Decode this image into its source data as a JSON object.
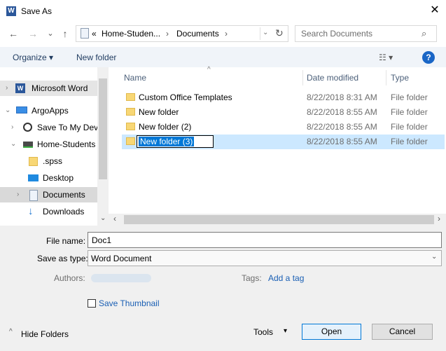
{
  "window": {
    "title": "Save As",
    "close_symbol": "✕"
  },
  "nav": {
    "back": "←",
    "forward": "→",
    "recent": "⌄",
    "up": "↑",
    "breadcrumb": [
      "«",
      "Home-Studen...",
      "›",
      "Documents",
      "›"
    ],
    "refresh": "↻",
    "search_placeholder": "Search Documents"
  },
  "toolbar": {
    "organize": "Organize ▾",
    "new_folder": "New folder",
    "view_glyph": "☷ ▾",
    "help": "?"
  },
  "sidebar": {
    "items": [
      {
        "label": "Microsoft Word",
        "chevron": "›",
        "icon": "word-icon"
      },
      {
        "label": "ArgoApps",
        "chevron": "⌄",
        "icon": "pc-icon"
      },
      {
        "label": "Save To My Devi",
        "chevron": "›",
        "icon": "disc-icon"
      },
      {
        "label": "Home-Students",
        "chevron": "⌄",
        "icon": "drive-icon"
      },
      {
        "label": ".spss",
        "chevron": "",
        "icon": "folder-icon"
      },
      {
        "label": "Desktop",
        "chevron": "",
        "icon": "desktop-icon"
      },
      {
        "label": "Documents",
        "chevron": "›",
        "icon": "documents-icon"
      },
      {
        "label": "Downloads",
        "chevron": "",
        "icon": "download-icon"
      }
    ],
    "scroll_down": "⌄"
  },
  "columns": {
    "name": "Name",
    "date": "Date modified",
    "type": "Type",
    "sort_arrow": "^"
  },
  "files": [
    {
      "name": "Custom Office Templates",
      "date": "8/22/2018 8:31 AM",
      "type": "File folder"
    },
    {
      "name": "New folder",
      "date": "8/22/2018 8:55 AM",
      "type": "File folder"
    },
    {
      "name": "New folder (2)",
      "date": "8/22/2018 8:55 AM",
      "type": "File folder"
    },
    {
      "name": "New folder (3)",
      "date": "8/22/2018 8:55 AM",
      "type": "File folder"
    }
  ],
  "scrollbar": {
    "left": "‹",
    "right": "›"
  },
  "form": {
    "file_name_label": "File name:",
    "file_name_value": "Doc1",
    "save_type_label": "Save as type:",
    "save_type_value": "Word Document",
    "dropdown_chevron": "⌄",
    "authors_label": "Authors:",
    "tags_label": "Tags:",
    "tags_link": "Add a tag",
    "thumbnail_label": "Save Thumbnail"
  },
  "footer": {
    "hide_folders": "Hide Folders",
    "hide_chevron": "^",
    "tools": "Tools",
    "tools_arrow": "▾",
    "open": "Open",
    "cancel": "Cancel"
  }
}
